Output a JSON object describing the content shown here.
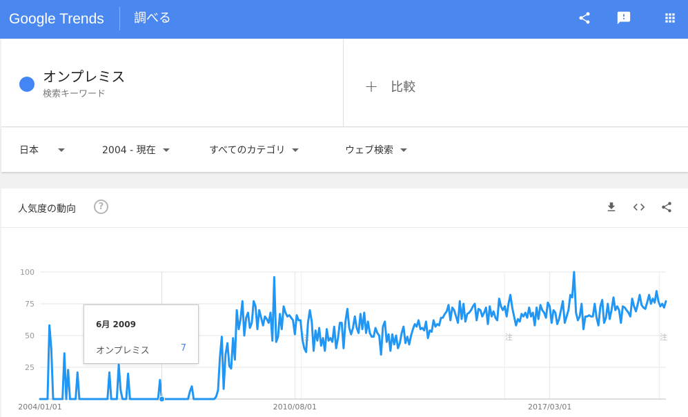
{
  "header": {
    "logo_text": "Google Trends",
    "section_title": "調べる"
  },
  "search_term": {
    "name": "オンプレミス",
    "type_label": "検索キーワード",
    "color": "#4285f4"
  },
  "compare": {
    "plus": "+",
    "label": "比較"
  },
  "filters": {
    "region": "日本",
    "time": "2004 - 現在",
    "category": "すべてのカテゴリ",
    "search_type": "ウェブ検索"
  },
  "interest_card": {
    "title": "人気度の動向",
    "help": "?"
  },
  "tooltip": {
    "date": "6月 2009",
    "term": "オンプレミス",
    "value": "7"
  },
  "colors": {
    "header_bg": "#4a87ee",
    "series": "#2196f3",
    "accent": "#4285f4"
  },
  "chart_data": {
    "type": "line",
    "x_start": "2004-01",
    "x_end": "2020-03",
    "ylim": [
      0,
      100
    ],
    "ytick_labels": [
      "100",
      "75",
      "50",
      "25"
    ],
    "yticks": [
      100,
      75,
      50,
      25
    ],
    "xtick_labels": [
      "2004/01/01",
      "2010/08/01",
      "2017/03/01"
    ],
    "xticks": [
      "2004-01",
      "2010-08",
      "2017-03"
    ],
    "note_marks": [
      {
        "date": "2010-10",
        "label": "注"
      },
      {
        "date": "2016-01",
        "label": "注"
      },
      {
        "date": "2020-01",
        "label": "注"
      }
    ],
    "hover_date": "2009-06",
    "series": [
      {
        "name": "オンプレミス",
        "values": [
          0,
          0,
          0,
          0,
          0,
          58,
          40,
          0,
          0,
          0,
          0,
          0,
          0,
          36,
          0,
          23,
          0,
          0,
          0,
          0,
          21,
          0,
          0,
          0,
          0,
          0,
          0,
          0,
          0,
          0,
          0,
          0,
          0,
          0,
          0,
          0,
          0,
          21,
          0,
          0,
          0,
          0,
          27,
          7,
          0,
          0,
          0,
          20,
          0,
          0,
          0,
          0,
          0,
          0,
          0,
          0,
          0,
          0,
          0,
          0,
          0,
          0,
          0,
          0,
          15,
          0,
          0,
          0,
          0,
          0,
          0,
          0,
          0,
          0,
          0,
          0,
          0,
          0,
          0,
          0,
          6,
          10,
          0,
          0,
          0,
          0,
          0,
          0,
          0,
          0,
          0,
          0,
          0,
          0,
          2,
          7,
          33,
          49,
          8,
          35,
          44,
          26,
          24,
          48,
          31,
          70,
          55,
          63,
          77,
          50,
          64,
          68,
          56,
          60,
          77,
          73,
          55,
          70,
          64,
          58,
          65,
          63,
          60,
          68,
          46,
          96,
          45,
          49,
          67,
          55,
          73,
          68,
          65,
          66,
          64,
          62,
          51,
          66,
          62,
          62,
          47,
          40,
          37,
          60,
          70,
          61,
          38,
          54,
          46,
          56,
          42,
          48,
          38,
          55,
          46,
          48,
          45,
          57,
          40,
          48,
          60,
          60,
          40,
          61,
          71,
          56,
          51,
          56,
          65,
          56,
          52,
          67,
          55,
          68,
          52,
          61,
          52,
          49,
          49,
          56,
          52,
          50,
          35,
          57,
          61,
          45,
          51,
          38,
          51,
          43,
          50,
          40,
          44,
          52,
          57,
          44,
          49,
          43,
          50,
          55,
          59,
          57,
          62,
          55,
          56,
          54,
          61,
          48,
          54,
          53,
          62,
          57,
          59,
          58,
          64,
          64,
          67,
          69,
          74,
          62,
          72,
          70,
          65,
          60,
          77,
          63,
          75,
          61,
          67,
          68,
          70,
          73,
          75,
          62,
          71,
          70,
          65,
          68,
          72,
          59,
          73,
          65,
          69,
          64,
          62,
          79,
          73,
          70,
          73,
          65,
          75,
          82,
          72,
          65,
          58,
          63,
          61,
          67,
          65,
          68,
          64,
          72,
          65,
          68,
          58,
          72,
          63,
          74,
          70,
          68,
          64,
          76,
          73,
          60,
          70,
          68,
          59,
          63,
          70,
          77,
          60,
          65,
          70,
          82,
          80,
          100,
          68,
          62,
          65,
          75,
          55,
          65,
          65,
          66,
          65,
          65,
          75,
          64,
          58,
          73,
          78,
          60,
          64,
          75,
          63,
          70,
          80,
          70,
          73,
          70,
          60,
          73,
          72,
          70,
          68,
          65,
          79,
          73,
          69,
          75,
          82,
          74,
          72,
          71,
          76,
          82,
          75,
          79,
          76,
          85,
          77,
          73,
          75,
          72,
          77
        ]
      }
    ]
  }
}
